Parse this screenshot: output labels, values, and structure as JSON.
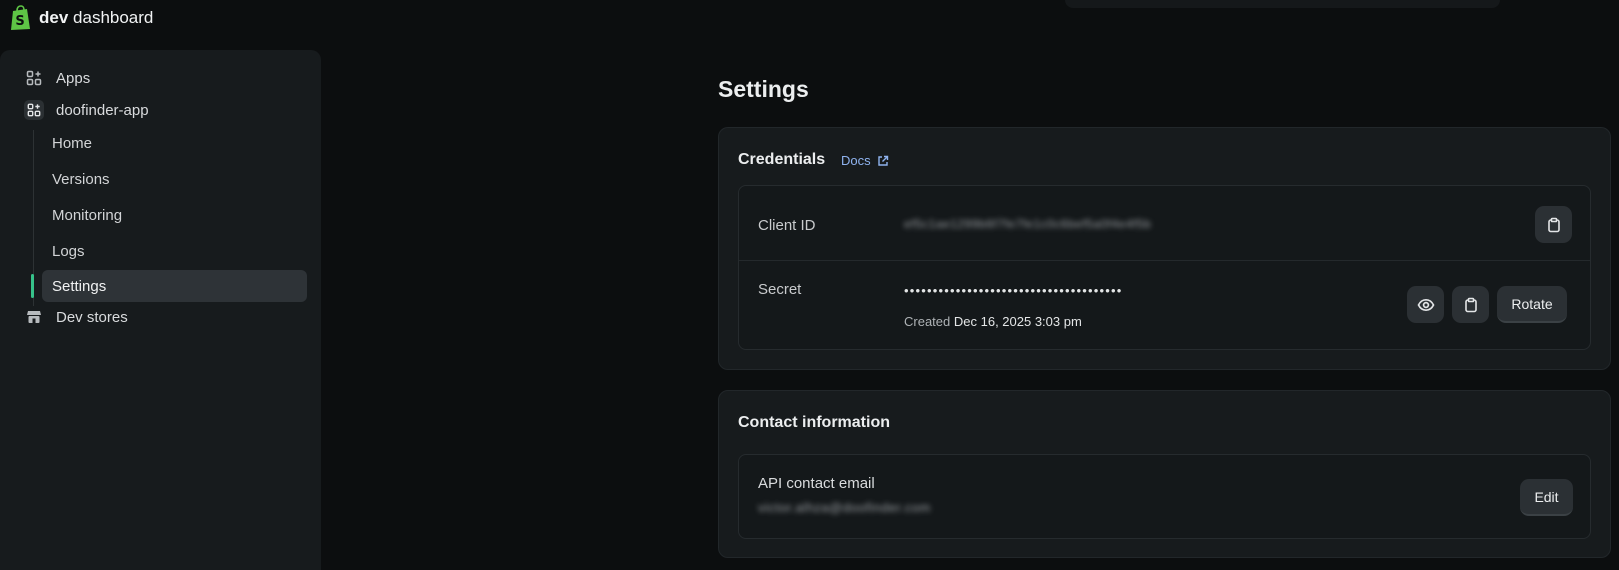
{
  "brand": {
    "bold": "dev",
    "rest": "dashboard"
  },
  "sidebar": {
    "apps_label": "Apps",
    "app_name": "doofinder-app",
    "items": [
      {
        "label": "Home"
      },
      {
        "label": "Versions"
      },
      {
        "label": "Monitoring"
      },
      {
        "label": "Logs"
      },
      {
        "label": "Settings",
        "active": true
      }
    ],
    "dev_stores_label": "Dev stores"
  },
  "page": {
    "title": "Settings"
  },
  "credentials": {
    "title": "Credentials",
    "docs_label": "Docs",
    "client_id_label": "Client ID",
    "client_id_value": "ef5c1ae1299b6f7fe7fe1c0c6bef5a0f4e4f5b",
    "secret_label": "Secret",
    "secret_masked": "••••••••••••••••••••••••••••••••••••••",
    "created_prefix": "Created",
    "created_date": "Dec 16, 2025 3:03 pm",
    "rotate_label": "Rotate"
  },
  "contact": {
    "title": "Contact information",
    "email_label": "API contact email",
    "email_value": "victor.alhza@doofinder.com",
    "edit_label": "Edit"
  },
  "colors": {
    "accent": "#36c28a",
    "link": "#8fb3ef",
    "brand": "#5ec545"
  }
}
